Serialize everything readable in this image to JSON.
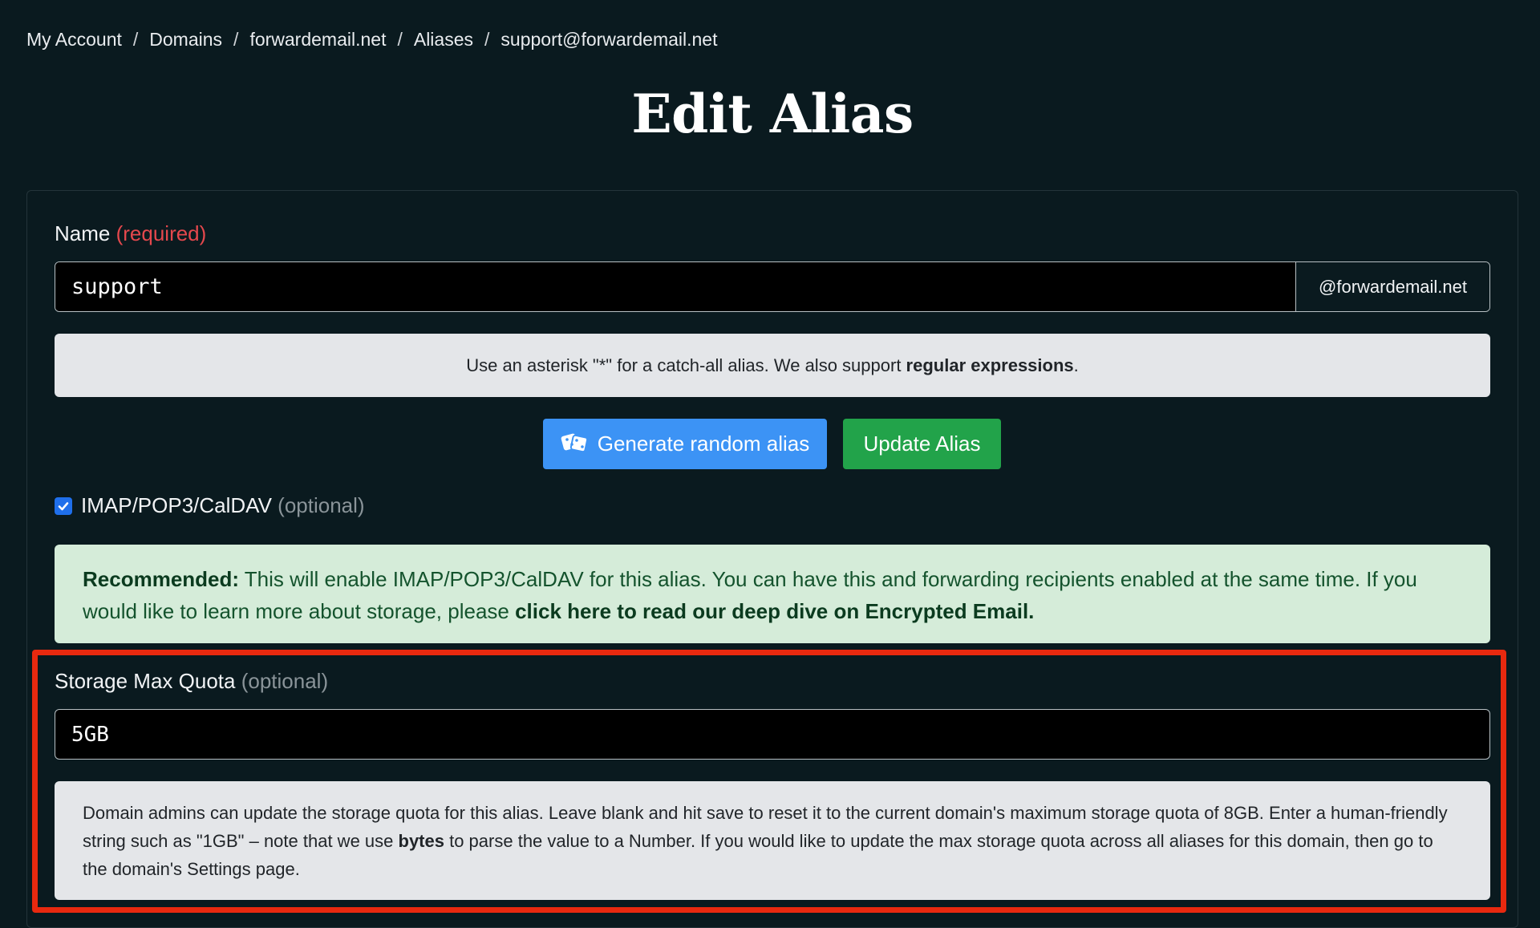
{
  "breadcrumb": {
    "items": [
      "My Account",
      "Domains",
      "forwardemail.net",
      "Aliases",
      "support@forwardemail.net"
    ],
    "separator": "/"
  },
  "page": {
    "title": "Edit Alias"
  },
  "name_field": {
    "label": "Name",
    "required": "(required)",
    "value": "support",
    "suffix": "@forwardemail.net"
  },
  "name_help": {
    "text_before": "Use an asterisk \"*\" for a catch-all alias. We also support ",
    "link": "regular expressions",
    "text_after": "."
  },
  "buttons": {
    "generate": "Generate random alias",
    "update": "Update Alias"
  },
  "imap": {
    "label": "IMAP/POP3/CalDAV",
    "optional": "(optional)",
    "checked": true
  },
  "alert": {
    "strong": "Recommended:",
    "text": " This will enable IMAP/POP3/CalDAV for this alias. You can have this and forwarding recipients enabled at the same time. If you would like to learn more about storage, please ",
    "link": "click here to read our deep dive on Encrypted Email."
  },
  "quota": {
    "label": "Storage Max Quota",
    "optional": "(optional)",
    "value": "5GB",
    "help_before": "Domain admins can update the storage quota for this alias. Leave blank and hit save to reset it to the current domain's maximum storage quota of 8GB. Enter a human-friendly string such as \"1GB\" – note that we use ",
    "help_bold": "bytes",
    "help_after": " to parse the value to a Number. If you would like to update the max storage quota across all aliases for this domain, then go to the domain's Settings page."
  },
  "colors": {
    "background": "#0a1a1f",
    "required": "#e5484d",
    "primary_button": "#3c93f5",
    "success_button": "#22a34a",
    "highlight_box": "#e8290f"
  }
}
